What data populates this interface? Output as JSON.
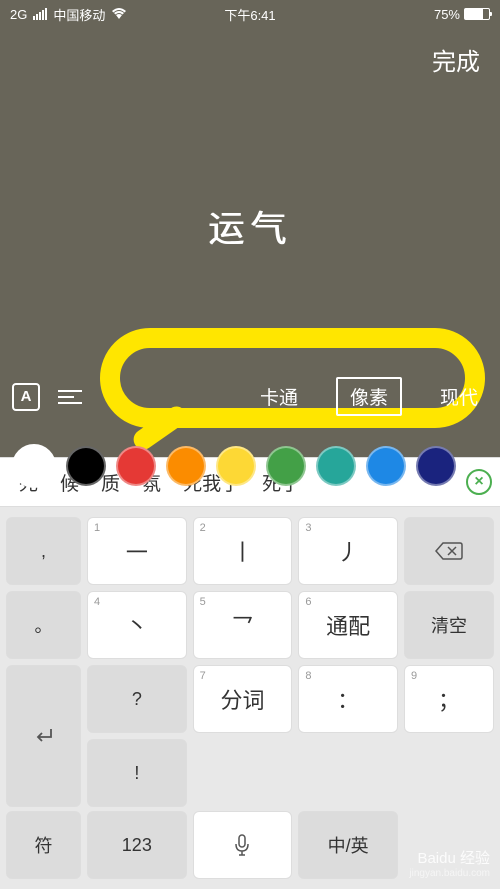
{
  "status": {
    "network_type": "2G",
    "carrier": "中国移动",
    "time": "下午6:41",
    "battery_percent": "75%"
  },
  "header": {
    "done": "完成"
  },
  "canvas": {
    "text": "运气"
  },
  "editbar": {
    "text_style_label": "A",
    "fonts": [
      {
        "label": "卡通",
        "selected": false
      },
      {
        "label": "像素",
        "selected": true
      },
      {
        "label": "现代",
        "selected": false
      }
    ]
  },
  "colors": [
    {
      "hex": "#ffffff",
      "selected": true
    },
    {
      "hex": "#000000",
      "selected": false
    },
    {
      "hex": "#e53935",
      "selected": false
    },
    {
      "hex": "#fb8c00",
      "selected": false
    },
    {
      "hex": "#fdd835",
      "selected": false
    },
    {
      "hex": "#43a047",
      "selected": false
    },
    {
      "hex": "#26a69a",
      "selected": false
    },
    {
      "hex": "#1e88e5",
      "selected": false
    },
    {
      "hex": "#1a237e",
      "selected": false
    }
  ],
  "keyboard": {
    "candidates": [
      "死",
      "候",
      "质",
      "氛",
      "死我了",
      "死了"
    ],
    "side_left": [
      ",",
      "。",
      "?",
      "!"
    ],
    "side_right": [
      "",
      "清空",
      ""
    ],
    "main_rows": [
      [
        {
          "num": "1",
          "ch": "一"
        },
        {
          "num": "2",
          "ch": "丨"
        },
        {
          "num": "3",
          "ch": "丿"
        }
      ],
      [
        {
          "num": "4",
          "ch": "丶"
        },
        {
          "num": "5",
          "ch": "乛"
        },
        {
          "num": "6",
          "ch": "通配"
        }
      ],
      [
        {
          "num": "7",
          "ch": "分词"
        },
        {
          "num": "8",
          "ch": "："
        },
        {
          "num": "9",
          "ch": "；"
        }
      ]
    ],
    "bottom": {
      "symbol": "符",
      "num123": "123",
      "lang": "中/英"
    },
    "backspace": "⌫"
  },
  "watermark": {
    "brand": "Baidu 经验",
    "url": "jingyan.baidu.com"
  }
}
